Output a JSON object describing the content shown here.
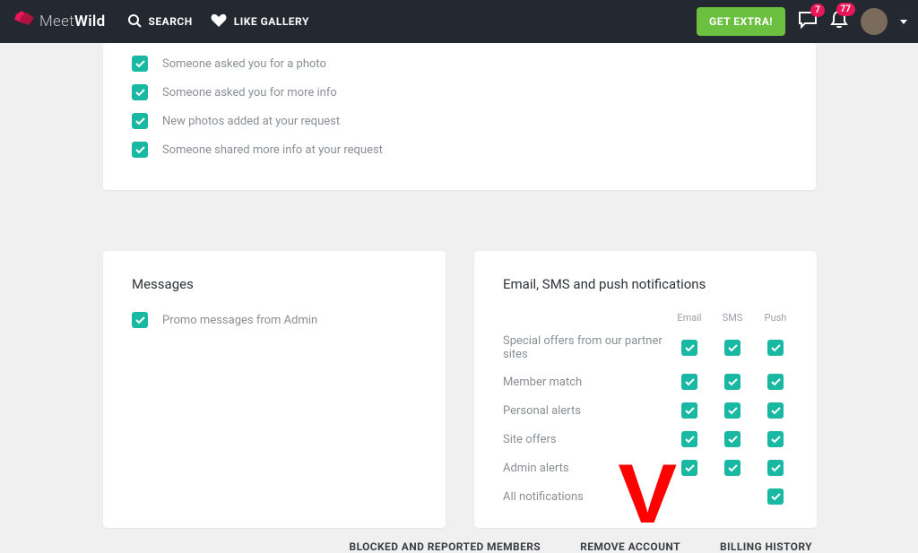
{
  "header": {
    "brand_a": "Meet",
    "brand_b": "Wild",
    "nav_search": "SEARCH",
    "nav_like": "LIKE GALLERY",
    "cta": "GET EXTRA!",
    "chat_count": "7",
    "bell_count": "77"
  },
  "top_card": {
    "items": [
      "Someone asked you for a photo",
      "Someone asked you for more info",
      "New photos added at your request",
      "Someone shared more info at your request"
    ]
  },
  "messages": {
    "title": "Messages",
    "item0": "Promo messages from Admin"
  },
  "notif": {
    "title": "Email, SMS and push notifications",
    "col_email": "Email",
    "col_sms": "SMS",
    "col_push": "Push",
    "rows": [
      "Special offers from our partner sites",
      "Member match",
      "Personal alerts",
      "Site offers",
      "Admin alerts",
      "All notifications"
    ]
  },
  "footer": {
    "blocked": "BLOCKED AND REPORTED MEMBERS",
    "remove": "REMOVE ACCOUNT",
    "billing": "BILLING HISTORY"
  }
}
